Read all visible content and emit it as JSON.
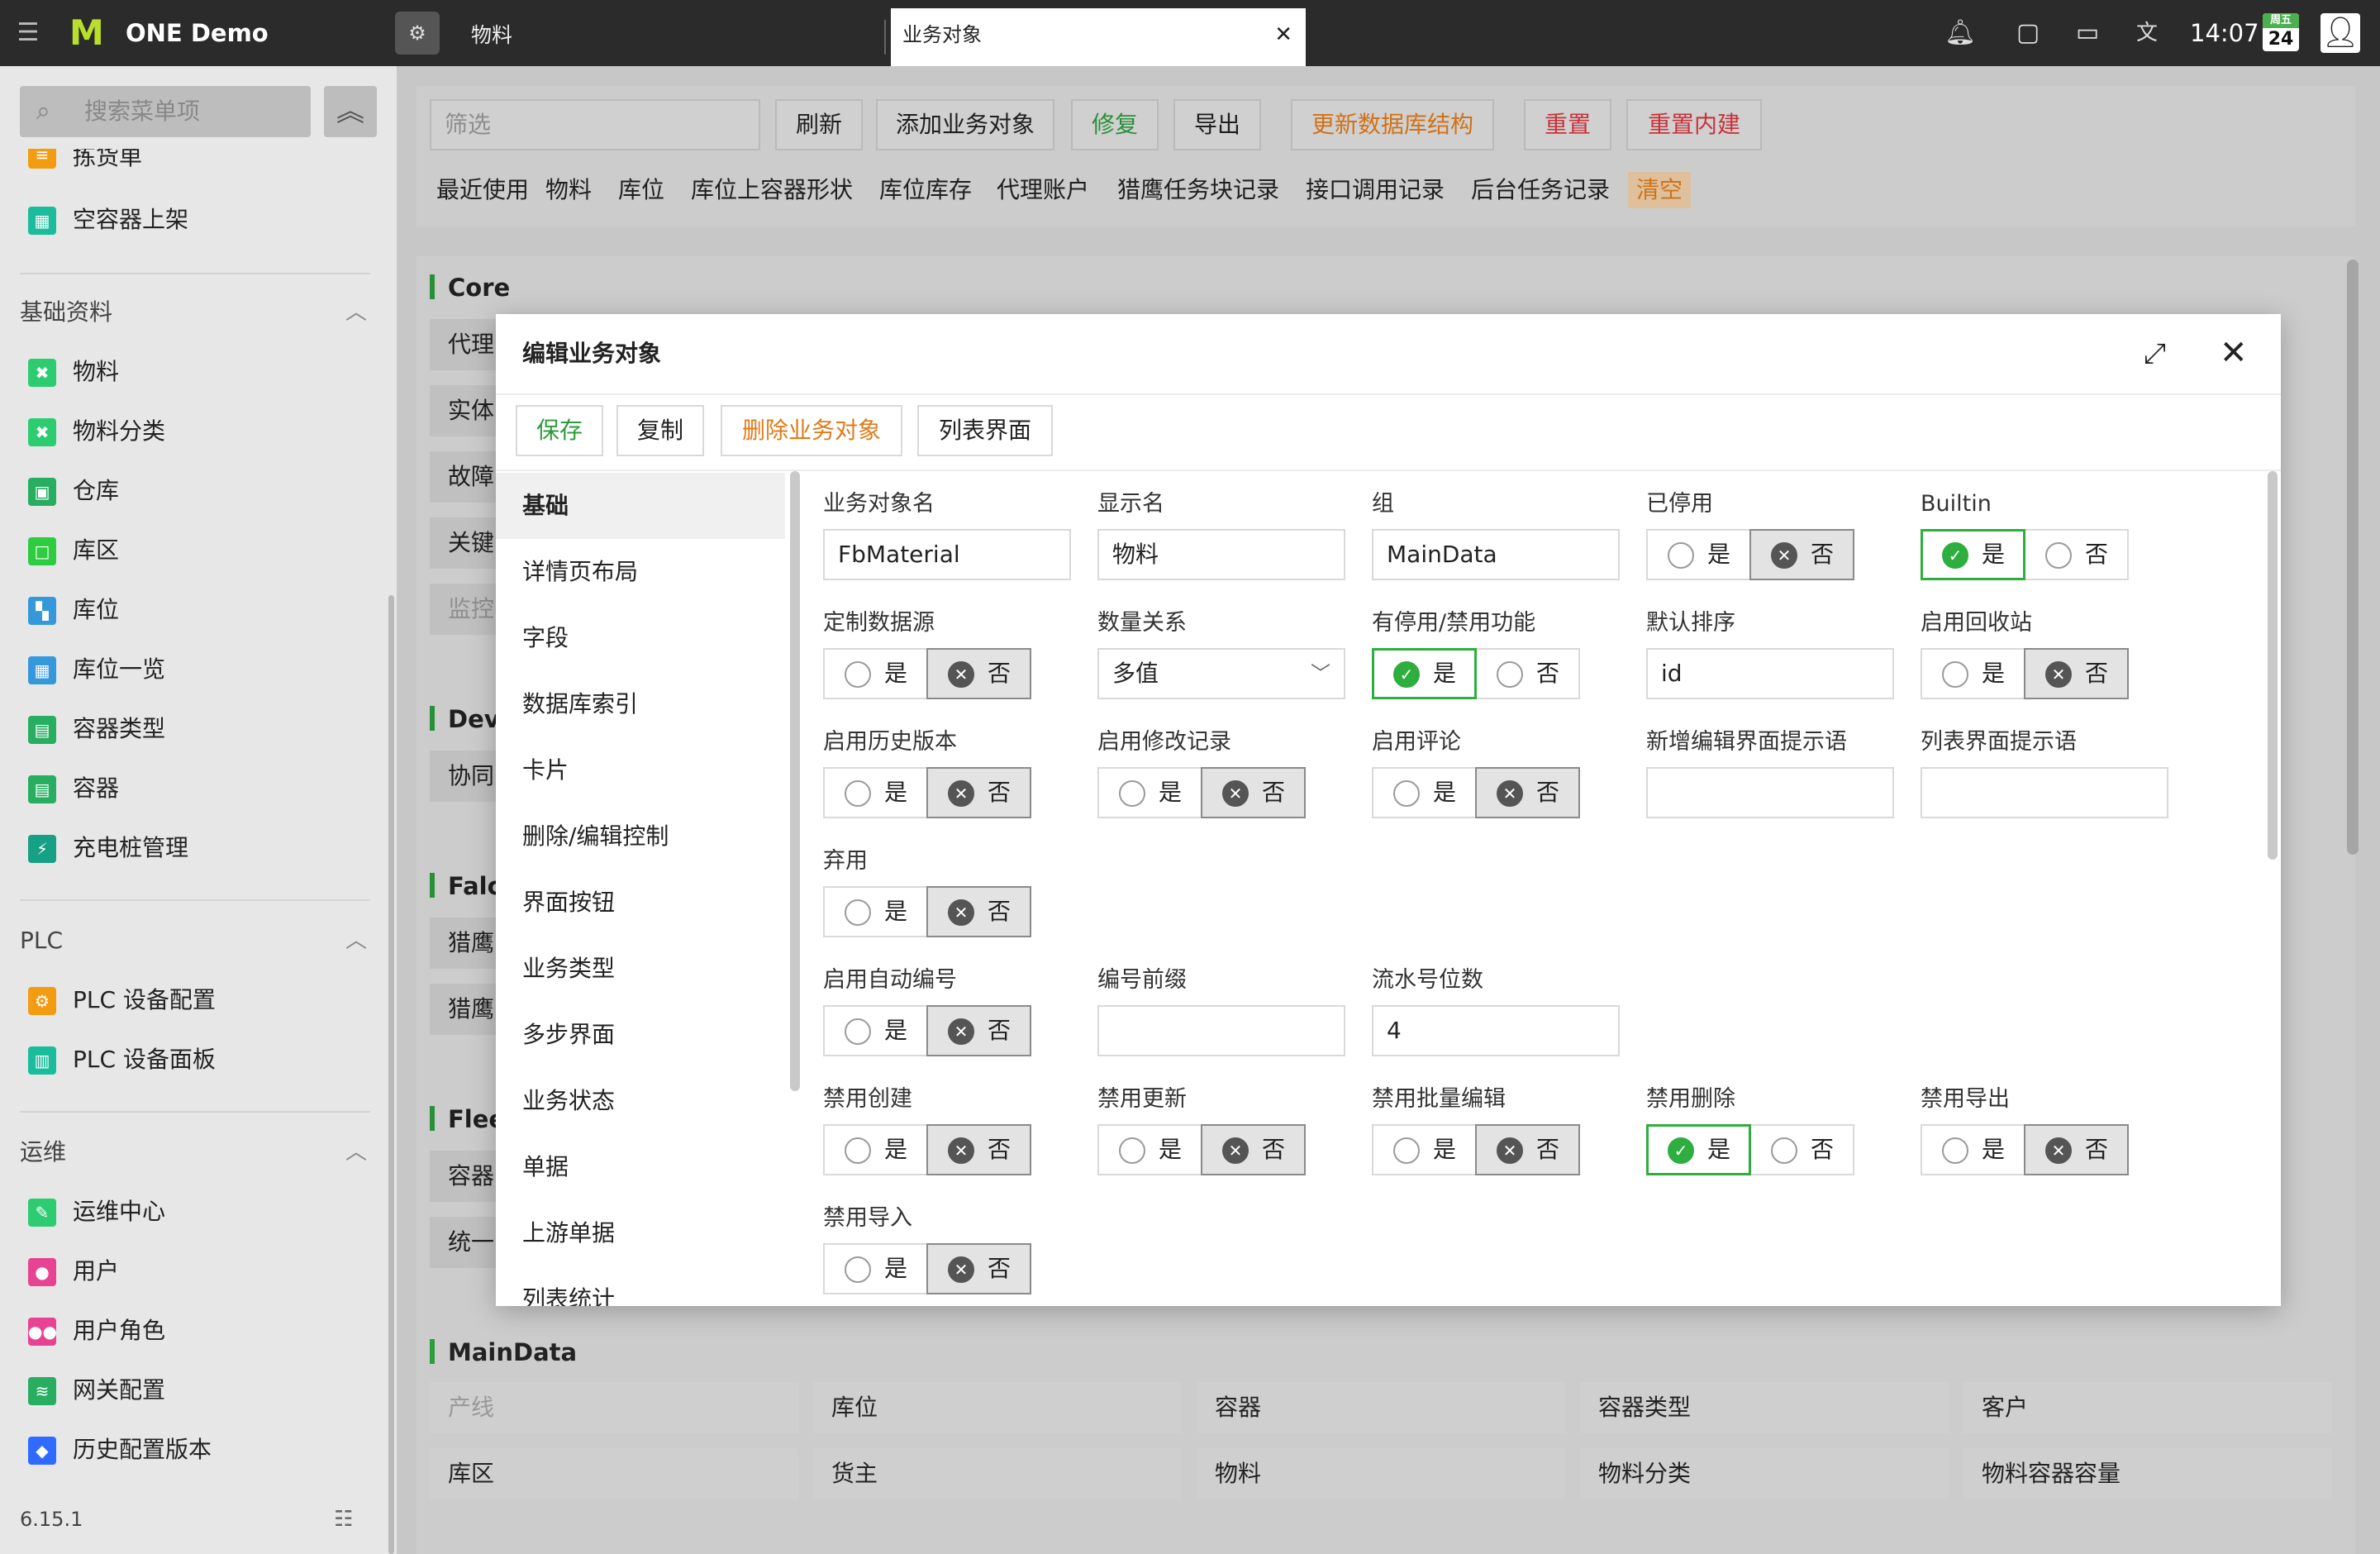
{
  "topbar": {
    "app_name": "ONE Demo",
    "logo": "M",
    "tab_material": "物料",
    "tab_business": "业务对象",
    "time": "14:07",
    "weekday": "周五",
    "day": "24"
  },
  "sidebar": {
    "search_placeholder": "搜索菜单项",
    "top_items": [
      {
        "label": "拣货单",
        "icon": "list-icon",
        "color": "#f39c12"
      },
      {
        "label": "空容器上架",
        "icon": "shelf-icon",
        "color": "#1abc9c"
      }
    ],
    "groups": [
      {
        "title": "基础资料",
        "items": [
          {
            "label": "物料",
            "icon": "tools-icon",
            "color": "#2ecc71"
          },
          {
            "label": "物料分类",
            "icon": "tools-icon",
            "color": "#2ecc71"
          },
          {
            "label": "仓库",
            "icon": "warehouse-icon",
            "color": "#27ae60"
          },
          {
            "label": "库区",
            "icon": "square-icon",
            "color": "#2ecc40"
          },
          {
            "label": "库位",
            "icon": "grid-icon",
            "color": "#3498db"
          },
          {
            "label": "库位一览",
            "icon": "grid-icon",
            "color": "#3498db"
          },
          {
            "label": "容器类型",
            "icon": "box-icon",
            "color": "#27ae60"
          },
          {
            "label": "容器",
            "icon": "box-icon",
            "color": "#27ae60"
          },
          {
            "label": "充电桩管理",
            "icon": "charger-icon",
            "color": "#16a085"
          }
        ]
      },
      {
        "title": "PLC",
        "items": [
          {
            "label": "PLC 设备配置",
            "icon": "gear-icon",
            "color": "#f39c12"
          },
          {
            "label": "PLC 设备面板",
            "icon": "panel-icon",
            "color": "#1abc9c"
          }
        ]
      },
      {
        "title": "运维",
        "items": [
          {
            "label": "运维中心",
            "icon": "wrench-icon",
            "color": "#2ecc71"
          },
          {
            "label": "用户",
            "icon": "user-icon",
            "color": "#e84393"
          },
          {
            "label": "用户角色",
            "icon": "users-icon",
            "color": "#e84393"
          },
          {
            "label": "网关配置",
            "icon": "gateway-icon",
            "color": "#27ae60"
          },
          {
            "label": "历史配置版本",
            "icon": "shield-icon",
            "color": "#2f6bff"
          }
        ]
      }
    ],
    "version": "6.15.1"
  },
  "toolbar": {
    "filter_placeholder": "筛选",
    "buttons": [
      {
        "label": "刷新",
        "color": "#222222"
      },
      {
        "label": "添加业务对象",
        "color": "#222222"
      },
      {
        "label": "修复",
        "color": "#2e9b3d"
      },
      {
        "label": "导出",
        "color": "#222222"
      },
      {
        "label": "更新数据库结构",
        "color": "#e07b1a"
      },
      {
        "label": "重置",
        "color": "#d9363e"
      },
      {
        "label": "重置内建",
        "color": "#d9363e"
      }
    ],
    "recent": [
      "最近使用",
      "物料",
      "库位",
      "库位上容器形状",
      "库位库存",
      "代理账户",
      "猎鹰任务块记录",
      "接口调用记录",
      "后台任务记录"
    ],
    "clear": "清空"
  },
  "sections": {
    "core": {
      "title": "Core",
      "rows": [
        "代理",
        "实体",
        "故障",
        "关键",
        "监控"
      ]
    },
    "dev": {
      "title": "Dev",
      "rows": [
        "协同"
      ]
    },
    "falcon": {
      "title": "Falc",
      "rows": [
        "猎鹰",
        "猎鹰"
      ]
    },
    "fleet": {
      "title": "Flee",
      "rows": [
        "容器",
        "统一"
      ]
    },
    "maindata": {
      "title": "MainData",
      "cells": [
        [
          "产线",
          "库位",
          "容器",
          "容器类型",
          "客户"
        ],
        [
          "库区",
          "货主",
          "物料",
          "物料分类",
          "物料容器容量"
        ]
      ]
    }
  },
  "modal": {
    "title": "编辑业务对象",
    "buttons": [
      {
        "label": "保存",
        "color": "#2e9b3d"
      },
      {
        "label": "复制",
        "color": "#222222"
      },
      {
        "label": "删除业务对象",
        "color": "#e07b1a"
      },
      {
        "label": "列表界面",
        "color": "#222222"
      }
    ],
    "nav": [
      "基础",
      "详情页布局",
      "字段",
      "数据库索引",
      "卡片",
      "删除/编辑控制",
      "界面按钮",
      "业务类型",
      "多步界面",
      "业务状态",
      "单据",
      "上游单据",
      "列表统计"
    ],
    "yes": "是",
    "no": "否",
    "fields": {
      "name": {
        "label": "业务对象名",
        "value": "FbMaterial"
      },
      "display": {
        "label": "显示名",
        "value": "物料"
      },
      "group": {
        "label": "组",
        "value": "MainData"
      },
      "disabled": {
        "label": "已停用",
        "value": "否"
      },
      "builtin": {
        "label": "Builtin",
        "value": "是"
      },
      "custom_source": {
        "label": "定制数据源",
        "value": "否"
      },
      "quantity": {
        "label": "数量关系",
        "value": "多值"
      },
      "has_disable": {
        "label": "有停用/禁用功能",
        "value": "是"
      },
      "default_sort": {
        "label": "默认排序",
        "value": "id"
      },
      "recycle": {
        "label": "启用回收站",
        "value": "否"
      },
      "history": {
        "label": "启用历史版本",
        "value": "否"
      },
      "change_log": {
        "label": "启用修改记录",
        "value": "否"
      },
      "comments": {
        "label": "启用评论",
        "value": "否"
      },
      "edit_hint": {
        "label": "新增编辑界面提示语",
        "value": ""
      },
      "list_hint": {
        "label": "列表界面提示语",
        "value": ""
      },
      "deprecated": {
        "label": "弃用",
        "value": "否"
      },
      "auto_number": {
        "label": "启用自动编号",
        "value": "否"
      },
      "number_prefix": {
        "label": "编号前缀",
        "value": ""
      },
      "serial_digits": {
        "label": "流水号位数",
        "value": "4"
      },
      "no_create": {
        "label": "禁用创建",
        "value": "否"
      },
      "no_update": {
        "label": "禁用更新",
        "value": "否"
      },
      "no_batch_edit": {
        "label": "禁用批量编辑",
        "value": "否"
      },
      "no_delete": {
        "label": "禁用删除",
        "value": "是"
      },
      "no_export": {
        "label": "禁用导出",
        "value": "否"
      },
      "no_import": {
        "label": "禁用导入",
        "value": "否"
      }
    }
  }
}
